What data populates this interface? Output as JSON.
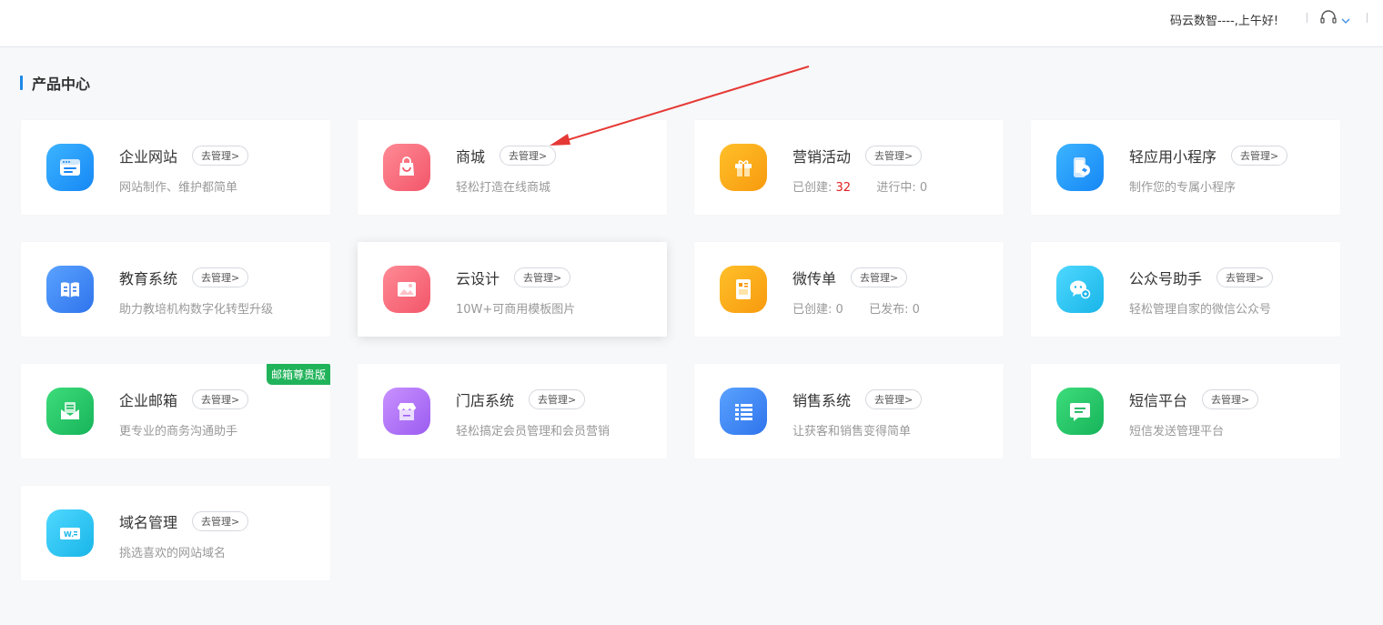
{
  "header": {
    "greeting": "码云数智----,上午好!"
  },
  "section": {
    "title": "产品中心"
  },
  "manage_label": "去管理>",
  "cards": [
    {
      "title": "企业网站",
      "desc": "网站制作、维护都简单"
    },
    {
      "title": "商城",
      "desc": "轻松打造在线商城"
    },
    {
      "title": "营销活动",
      "stat1_label": "已创建:",
      "stat1_value": "32",
      "stat2_label": "进行中:",
      "stat2_value": "0"
    },
    {
      "title": "轻应用小程序",
      "desc": "制作您的专属小程序"
    },
    {
      "title": "教育系统",
      "desc": "助力教培机构数字化转型升级"
    },
    {
      "title": "云设计",
      "desc": "10W+可商用模板图片"
    },
    {
      "title": "微传单",
      "stat1_label": "已创建:",
      "stat1_value": "0",
      "stat2_label": "已发布:",
      "stat2_value": "0"
    },
    {
      "title": "公众号助手",
      "desc": "轻松管理自家的微信公众号"
    },
    {
      "title": "企业邮箱",
      "desc": "更专业的商务沟通助手",
      "badge": "邮箱尊贵版"
    },
    {
      "title": "门店系统",
      "desc": "轻松搞定会员管理和会员营销"
    },
    {
      "title": "销售系统",
      "desc": "让获客和销售变得简单"
    },
    {
      "title": "短信平台",
      "desc": "短信发送管理平台"
    },
    {
      "title": "域名管理",
      "desc": "挑选喜欢的网站域名"
    }
  ],
  "colors": {
    "accent": "#1e88e5",
    "highlight": "#e02020",
    "badge": "#21b35a",
    "annotation_arrow": "#e53935"
  },
  "icons": [
    "headset-icon",
    "chevron-down-icon",
    "browser-window-icon",
    "shopping-bag-icon",
    "gift-icon",
    "mini-program-icon",
    "book-icon",
    "image-icon",
    "flyer-icon",
    "wechat-gear-icon",
    "mail-icon",
    "storefront-icon",
    "list-icon",
    "message-icon",
    "domain-w-icon"
  ]
}
